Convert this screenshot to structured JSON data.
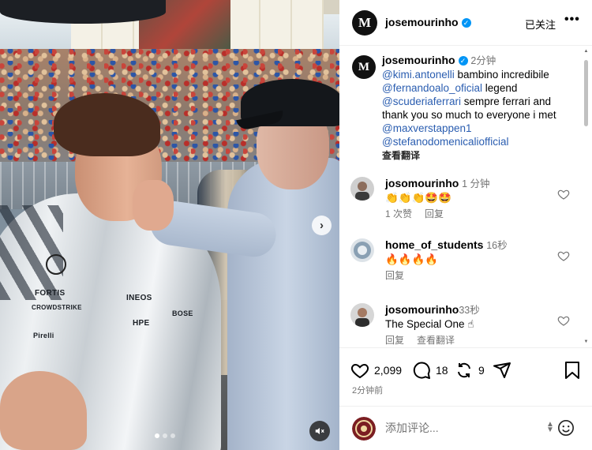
{
  "media": {
    "sponsors": [
      "FORTIS",
      "INEOS",
      "HPE",
      "CROWDSTRIKE",
      "Pirelli",
      "BOSE"
    ],
    "carousel_dots": 3,
    "active_dot": 0,
    "next_icon": "chevron-right-icon",
    "mute_icon": "speaker-muted-icon"
  },
  "header": {
    "avatar_letter": "M",
    "username": "josemourinho",
    "verified_icon": "verified-badge-icon",
    "follow_label": "已关注",
    "more_label": "•••"
  },
  "caption": {
    "username": "josemourinho",
    "time": "2分钟",
    "lines": [
      {
        "mention": "@kimi.antonelli",
        "text": " bambino incredibile"
      },
      {
        "mention": "@fernandoalo_oficial",
        "text": " legend"
      },
      {
        "mention": "@scuderiaferrari",
        "text": " sempre ferrari and"
      },
      {
        "mention": "",
        "text": "thank you so much to everyone i met"
      },
      {
        "mention": "@maxverstappen1",
        "text": ""
      },
      {
        "mention": "@stefanodomenicaliofficial",
        "text": ""
      }
    ],
    "see_translation": "查看翻译"
  },
  "comments": [
    {
      "username": "josomourinho",
      "time": "1 分钟",
      "text": "👏👏👏🤩🤩",
      "likes": "1 次赞",
      "reply": "回复",
      "translate": ""
    },
    {
      "username": "home_of_students",
      "time": "16秒",
      "text": "🔥🔥🔥🔥",
      "likes": "",
      "reply": "回复",
      "translate": ""
    },
    {
      "username": "josomourinho",
      "time": "33秒",
      "text": "The Special One ☝",
      "likes": "",
      "reply": "回复",
      "translate": "查看翻译"
    }
  ],
  "actions": {
    "like_count": "2,099",
    "comment_count": "18",
    "repost_count": "9",
    "time_ago": "2分钟前"
  },
  "add_comment": {
    "placeholder": "添加评论...",
    "emoji_icon": "smiley-icon"
  },
  "colors": {
    "mention": "#2a5db0",
    "muted": "#737373",
    "verified": "#0095f6"
  }
}
